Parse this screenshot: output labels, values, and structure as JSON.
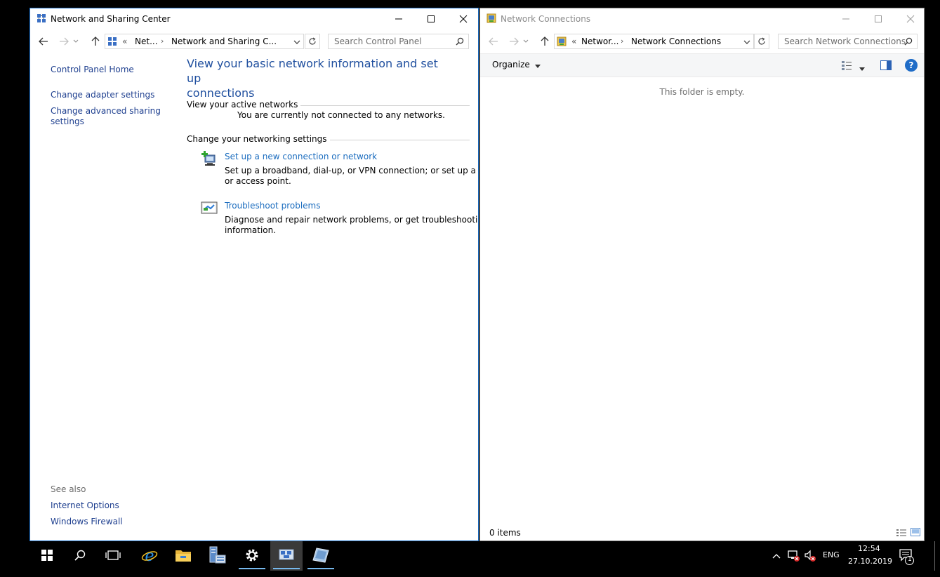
{
  "left_window": {
    "title": "Network and Sharing Center",
    "address": {
      "overflow": "«",
      "crumbs": [
        "Net...",
        "Network and Sharing C..."
      ]
    },
    "search_placeholder": "Search Control Panel",
    "sidebar": {
      "home": "Control Panel Home",
      "links": [
        "Change adapter settings",
        "Change advanced sharing",
        "settings"
      ],
      "see_also": "See also",
      "see_also_links": [
        "Internet Options",
        "Windows Firewall"
      ]
    },
    "main": {
      "heading_line1": "View your basic network information and set up",
      "heading_line2": "connections",
      "active_networks_label": "View your active networks",
      "not_connected": "You are currently not connected to any networks.",
      "change_settings_label": "Change your networking settings",
      "tasks": [
        {
          "title": "Set up a new connection or network",
          "desc1": "Set up a broadband, dial-up, or VPN connection; or set up a router",
          "desc2": "or access point."
        },
        {
          "title": "Troubleshoot problems",
          "desc1": "Diagnose and repair network problems, or get troubleshooting",
          "desc2": "information."
        }
      ]
    }
  },
  "right_window": {
    "title": "Network Connections",
    "address": {
      "overflow": "«",
      "crumbs": [
        "Networ...",
        "Network Connections"
      ]
    },
    "search_placeholder": "Search Network Connections",
    "toolbar": {
      "organize": "Organize"
    },
    "empty_text": "This folder is empty.",
    "status": "0 items",
    "help_icon_char": "?"
  },
  "taskbar": {
    "apps": [
      "start-icon",
      "search-icon",
      "task-view-icon",
      "internet-explorer-icon",
      "file-explorer-icon",
      "server-manager-icon",
      "settings-icon",
      "network-center-icon",
      "network-connections-icon"
    ],
    "language": "ENG",
    "time": "12:54",
    "date": "27.10.2019",
    "notification_count": "1"
  },
  "colors": {
    "accent": "#1a6fc9",
    "link": "#1e3f8f",
    "heading": "#1e4e9e",
    "taskbar_indicator": "#76b9ed"
  }
}
